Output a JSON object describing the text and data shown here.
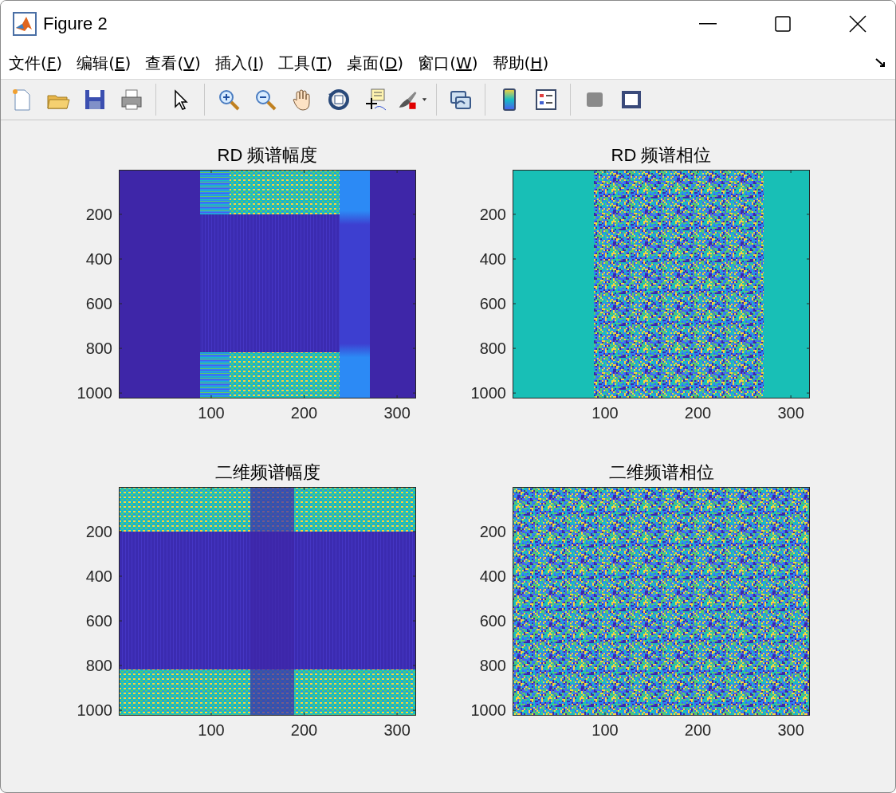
{
  "window": {
    "title": "Figure 2"
  },
  "menu": [
    {
      "before": "文件(",
      "key": "F",
      "after": ")"
    },
    {
      "before": "编辑(",
      "key": "E",
      "after": ")"
    },
    {
      "before": "查看(",
      "key": "V",
      "after": ")"
    },
    {
      "before": "插入(",
      "key": "I",
      "after": ")"
    },
    {
      "before": "工具(",
      "key": "T",
      "after": ")"
    },
    {
      "before": "桌面(",
      "key": "D",
      "after": ")"
    },
    {
      "before": "窗口(",
      "key": "W",
      "after": ")"
    },
    {
      "before": "帮助(",
      "key": "H",
      "after": ")"
    }
  ],
  "plots": [
    {
      "title": "RD 频谱幅度",
      "kind": "rd_magnitude",
      "xticks": [
        "100",
        "200",
        "300"
      ],
      "yticks": [
        "200",
        "400",
        "600",
        "800",
        "1000"
      ]
    },
    {
      "title": "RD 频谱相位",
      "kind": "rd_phase",
      "xticks": [
        "100",
        "200",
        "300"
      ],
      "yticks": [
        "200",
        "400",
        "600",
        "800",
        "1000"
      ]
    },
    {
      "title": "二维频谱幅度",
      "kind": "magnitude_2d",
      "xticks": [
        "100",
        "200",
        "300"
      ],
      "yticks": [
        "200",
        "400",
        "600",
        "800",
        "1000"
      ]
    },
    {
      "title": "二维频谱相位",
      "kind": "phase_2d",
      "xticks": [
        "100",
        "200",
        "300"
      ],
      "yticks": [
        "200",
        "400",
        "600",
        "800",
        "1000"
      ]
    }
  ]
}
